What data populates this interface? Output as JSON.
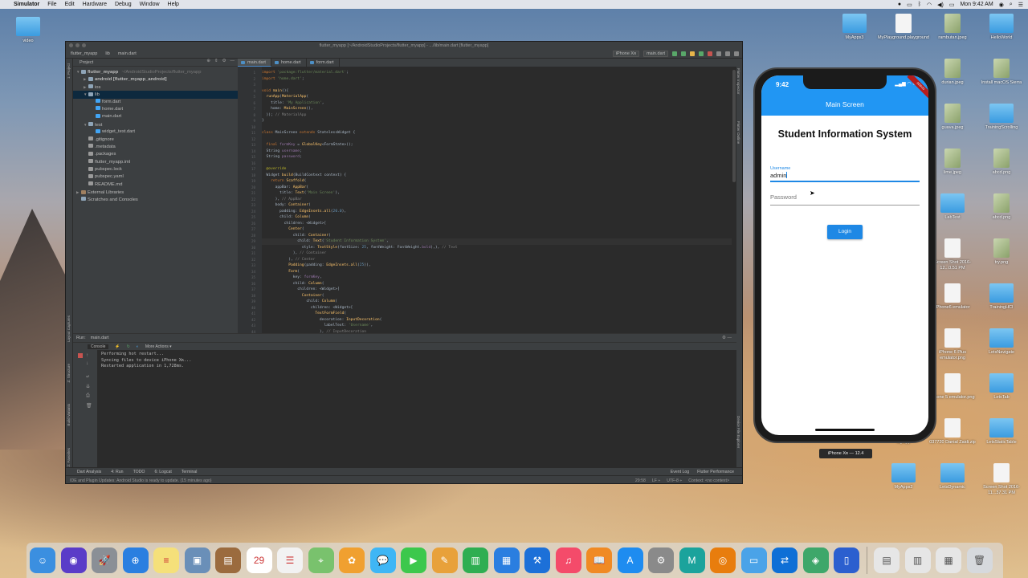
{
  "menubar": {
    "apple": "",
    "items": [
      "Simulator",
      "File",
      "Edit",
      "Hardware",
      "Debug",
      "Window",
      "Help"
    ],
    "clock": "Mon 9:42 AM"
  },
  "desktop": {
    "left_icons": [
      {
        "label": "video"
      }
    ],
    "right_icons": [
      {
        "label": "MyApps3",
        "kind": "folder",
        "col": 0,
        "row": 0
      },
      {
        "label": "MyPlayground.playground",
        "kind": "file",
        "col": 1,
        "row": 0
      },
      {
        "label": "rambutan.jpeg",
        "kind": "img",
        "col": 2,
        "row": 0
      },
      {
        "label": "HelloWorld",
        "kind": "folder",
        "col": 3,
        "row": 0
      },
      {
        "label": "durian.jpeg",
        "kind": "img",
        "col": 2,
        "row": 1
      },
      {
        "label": "Install macOS Sierra",
        "kind": "img",
        "col": 3,
        "row": 1
      },
      {
        "label": "guava.jpeg",
        "kind": "img",
        "col": 2,
        "row": 2
      },
      {
        "label": "TrainingScrolling",
        "kind": "folder",
        "col": 3,
        "row": 2
      },
      {
        "label": "lime.jpeg",
        "kind": "img",
        "col": 2,
        "row": 3
      },
      {
        "label": "abcd.png",
        "kind": "img",
        "col": 3,
        "row": 3
      },
      {
        "label": "LabTest",
        "kind": "folder",
        "col": 2,
        "row": 4
      },
      {
        "label": "abcd.png",
        "kind": "img",
        "col": 3,
        "row": 4
      },
      {
        "label": "Screen Shot 2016-12...0.51 PM",
        "kind": "file",
        "col": 2,
        "row": 5
      },
      {
        "label": "try.png",
        "kind": "img",
        "col": 3,
        "row": 5
      },
      {
        "label": "iPhone6 emulator",
        "kind": "file",
        "col": 2,
        "row": 6
      },
      {
        "label": "TrainingHCI",
        "kind": "folder",
        "col": 3,
        "row": 6
      },
      {
        "label": "iPhone 6 Plus emulator.png",
        "kind": "file",
        "col": 2,
        "row": 7
      },
      {
        "label": "LetsNavigate",
        "kind": "folder",
        "col": 3,
        "row": 7
      },
      {
        "label": "iPhone 5 emulator.png",
        "kind": "file",
        "col": 2,
        "row": 8
      },
      {
        "label": "LetsTab",
        "kind": "folder",
        "col": 3,
        "row": 8
      },
      {
        "label": "MyApp",
        "kind": "folder",
        "col": 1,
        "row": 9
      },
      {
        "label": "037720 Danial Zaidi.zip",
        "kind": "file",
        "col": 2,
        "row": 9
      },
      {
        "label": "LetsStaticTable",
        "kind": "folder",
        "col": 3,
        "row": 9
      },
      {
        "label": "MyApps2",
        "kind": "folder",
        "col": 1,
        "row": 10
      },
      {
        "label": "LetsDynamic",
        "kind": "folder",
        "col": 2,
        "row": 10
      },
      {
        "label": "Screen Shot 2016-11...37.31 PM",
        "kind": "file",
        "col": 3,
        "row": 10
      }
    ]
  },
  "ide": {
    "title": "flutter_myapp [~/AndroidStudioProjects/flutter_myapp] - .../lib/main.dart [flutter_myapp]",
    "breadcrumbs": [
      "flutter_myapp",
      "lib",
      "main.dart"
    ],
    "device_selector": "iPhone Xʀ",
    "run_config": "main.dart",
    "project_panel_title": "Project",
    "tree": [
      {
        "label": "flutter_myapp",
        "extra": "~/AndroidStudioProjects/flutter_myapp",
        "depth": 0,
        "arrow": "▼",
        "icon": "folder",
        "bold": true
      },
      {
        "label": "android [flutter_myapp_android]",
        "depth": 1,
        "arrow": "▶",
        "icon": "folder",
        "bold": true
      },
      {
        "label": "ios",
        "depth": 1,
        "arrow": "▶",
        "icon": "folder"
      },
      {
        "label": "lib",
        "depth": 1,
        "arrow": "▼",
        "icon": "folder",
        "selected": true
      },
      {
        "label": "form.dart",
        "depth": 2,
        "icon": "dart"
      },
      {
        "label": "home.dart",
        "depth": 2,
        "icon": "dart"
      },
      {
        "label": "main.dart",
        "depth": 2,
        "icon": "dart"
      },
      {
        "label": "test",
        "depth": 1,
        "arrow": "▼",
        "icon": "folder"
      },
      {
        "label": "widget_test.dart",
        "depth": 2,
        "icon": "dart"
      },
      {
        "label": ".gitignore",
        "depth": 1,
        "icon": "file"
      },
      {
        "label": ".metadata",
        "depth": 1,
        "icon": "file"
      },
      {
        "label": ".packages",
        "depth": 1,
        "icon": "file"
      },
      {
        "label": "flutter_myapp.iml",
        "depth": 1,
        "icon": "file"
      },
      {
        "label": "pubspec.lock",
        "depth": 1,
        "icon": "file"
      },
      {
        "label": "pubspec.yaml",
        "depth": 1,
        "icon": "file"
      },
      {
        "label": "README.md",
        "depth": 1,
        "icon": "file"
      },
      {
        "label": "External Libraries",
        "depth": 0,
        "arrow": "▶",
        "icon": "lib"
      },
      {
        "label": "Scratches and Consoles",
        "depth": 0,
        "icon": "scratch"
      }
    ],
    "tabs": [
      "main.dart",
      "home.dart",
      "form.dart"
    ],
    "line_start": 1,
    "code": [
      [
        [
          "kw",
          "import "
        ],
        [
          "str",
          "'package:flutter/material.dart'"
        ],
        [
          "",
          "; "
        ]
      ],
      [
        [
          "kw",
          "import "
        ],
        [
          "str",
          "'home.dart'"
        ],
        [
          "",
          ";"
        ]
      ],
      [
        [
          "",
          ""
        ]
      ],
      [
        [
          "kw",
          "void "
        ],
        [
          "fn",
          "main"
        ],
        [
          "",
          "(){"
        ]
      ],
      [
        [
          "",
          "  "
        ],
        [
          "fn",
          "runApp"
        ],
        [
          "",
          "("
        ],
        [
          "fn",
          "MaterialApp"
        ],
        [
          "",
          "("
        ]
      ],
      [
        [
          "",
          "    title: "
        ],
        [
          "str",
          "'My Application'"
        ],
        [
          "",
          ","
        ]
      ],
      [
        [
          "",
          "    home: "
        ],
        [
          "fn",
          "MainScreen"
        ],
        [
          "",
          "(),"
        ]
      ],
      [
        [
          "",
          "  )); "
        ],
        [
          "cm",
          "// MaterialApp"
        ]
      ],
      [
        [
          "",
          "}"
        ]
      ],
      [
        [
          "",
          ""
        ]
      ],
      [
        [
          "kw",
          "class "
        ],
        [
          "cls",
          "MainScreen "
        ],
        [
          "kw",
          "extends "
        ],
        [
          "",
          "StatelessWidget {"
        ]
      ],
      [
        [
          "",
          ""
        ]
      ],
      [
        [
          "",
          "  "
        ],
        [
          "kw",
          "final "
        ],
        [
          "pur",
          "formKey"
        ],
        [
          "",
          " = "
        ],
        [
          "fn",
          "GlobalKey"
        ],
        [
          "",
          "<FormState>();"
        ]
      ],
      [
        [
          "",
          "  String "
        ],
        [
          "pur",
          "username"
        ],
        [
          "",
          ";"
        ]
      ],
      [
        [
          "",
          "  String "
        ],
        [
          "pur",
          "password"
        ],
        [
          "",
          ";"
        ]
      ],
      [
        [
          "",
          ""
        ]
      ],
      [
        [
          "ann",
          "  @override"
        ]
      ],
      [
        [
          "",
          "  Widget "
        ],
        [
          "fn",
          "build"
        ],
        [
          "",
          "(BuildContext context) {"
        ]
      ],
      [
        [
          "",
          "    "
        ],
        [
          "kw",
          "return "
        ],
        [
          "fn",
          "Scaffold"
        ],
        [
          "",
          "("
        ]
      ],
      [
        [
          "",
          "      appBar: "
        ],
        [
          "fn",
          "AppBar"
        ],
        [
          "",
          "("
        ]
      ],
      [
        [
          "",
          "        title: "
        ],
        [
          "fn",
          "Text"
        ],
        [
          "",
          "("
        ],
        [
          "str",
          "'Main Screen'"
        ],
        [
          "",
          "),"
        ]
      ],
      [
        [
          "",
          "      ), "
        ],
        [
          "cm",
          "// AppBar"
        ]
      ],
      [
        [
          "",
          "      body: "
        ],
        [
          "fn",
          "Container"
        ],
        [
          "",
          "("
        ]
      ],
      [
        [
          "",
          "        padding: "
        ],
        [
          "fn",
          "EdgeInsets.all"
        ],
        [
          "",
          "("
        ],
        [
          "num",
          "20.0"
        ],
        [
          "",
          "),"
        ]
      ],
      [
        [
          "",
          "        child: "
        ],
        [
          "fn",
          "Column"
        ],
        [
          "",
          "("
        ]
      ],
      [
        [
          "",
          "          children: <Widget>["
        ]
      ],
      [
        [
          "",
          "            "
        ],
        [
          "fn",
          "Center"
        ],
        [
          "",
          "("
        ]
      ],
      [
        [
          "",
          "              child: "
        ],
        [
          "fn",
          "Container"
        ],
        [
          "",
          "("
        ]
      ],
      [
        [
          "",
          "                child: "
        ],
        [
          "fn",
          "Text"
        ],
        [
          "",
          "("
        ],
        [
          "str",
          "'Student Information System'"
        ],
        [
          "",
          ","
        ]
      ],
      [
        [
          "",
          "                  style: "
        ],
        [
          "fn",
          "TextStyle"
        ],
        [
          "",
          "(fontSize: "
        ],
        [
          "num",
          "25"
        ],
        [
          "",
          ", fontWeight: FontWeight."
        ],
        [
          "pur",
          "bold"
        ],
        [
          "",
          "),), "
        ],
        [
          "cm",
          "// Text"
        ]
      ],
      [
        [
          "",
          "              ), "
        ],
        [
          "cm",
          "// Container"
        ]
      ],
      [
        [
          "",
          "            ), "
        ],
        [
          "cm",
          "// Center"
        ]
      ],
      [
        [
          "",
          "            "
        ],
        [
          "fn",
          "Padding"
        ],
        [
          "",
          "(padding: "
        ],
        [
          "fn",
          "EdgeInsets.all"
        ],
        [
          "",
          "("
        ],
        [
          "num",
          "25"
        ],
        [
          "",
          ")),"
        ]
      ],
      [
        [
          "",
          "            "
        ],
        [
          "fn",
          "Form"
        ],
        [
          "",
          "("
        ]
      ],
      [
        [
          "",
          "              key: "
        ],
        [
          "pur",
          "formKey"
        ],
        [
          "",
          ","
        ]
      ],
      [
        [
          "",
          "              child: "
        ],
        [
          "fn",
          "Column"
        ],
        [
          "",
          "("
        ]
      ],
      [
        [
          "",
          "                children: <Widget>["
        ]
      ],
      [
        [
          "",
          "                  "
        ],
        [
          "fn",
          "Container"
        ],
        [
          "",
          "("
        ]
      ],
      [
        [
          "",
          "                    child: "
        ],
        [
          "fn",
          "Column"
        ],
        [
          "",
          "("
        ]
      ],
      [
        [
          "",
          "                      children: <Widget>["
        ]
      ],
      [
        [
          "",
          "                        "
        ],
        [
          "fn",
          "TextFormField"
        ],
        [
          "",
          "("
        ]
      ],
      [
        [
          "",
          "                          decoration: "
        ],
        [
          "fn",
          "InputDecoration"
        ],
        [
          "",
          "("
        ]
      ],
      [
        [
          "",
          "                            labelText: "
        ],
        [
          "str",
          "'Username'"
        ],
        [
          "",
          ","
        ]
      ],
      [
        [
          "",
          "                          ), "
        ],
        [
          "cm",
          "// InputDecoration"
        ]
      ]
    ],
    "highlight_line": 29,
    "run_label": "Run:",
    "run_tab": "main.dart",
    "console_tab": "Console",
    "more_actions": "More Actions ▾",
    "console_lines": [
      "Performing hot restart...",
      "Syncing files to device iPhone Xʀ...",
      "Restarted application in 1,728ms."
    ],
    "bottom_tools": [
      "Dart Analysis",
      "4: Run",
      "TODO",
      "6: Logcat",
      "Terminal"
    ],
    "bottom_right": [
      "Event Log",
      "Flutter Performance"
    ],
    "status_text": "IDE and Plugin Updates: Android Studio is ready to update. (15 minutes ago)",
    "status_right": [
      "29:58",
      "LF ÷",
      "UTF-8 ÷",
      "Context: <no context>"
    ],
    "left_vlabels": [
      "1: Project",
      "Layout Captures",
      "Z: Structure",
      "Build Variants",
      "2: Favorites"
    ],
    "right_vlabels": [
      "Flutter Inspector",
      "Flutter Outline",
      "Device File Explorer"
    ]
  },
  "simulator": {
    "time": "9:42",
    "appbar_title": "Main Screen",
    "debug_banner": "DEBUG",
    "heading": "Student Information System",
    "username_label": "Username",
    "username_value": "admin",
    "password_placeholder": "Password",
    "login_label": "Login",
    "device_label": "iPhone Xʀ — 12.4"
  },
  "dock": {
    "apps": [
      {
        "name": "finder",
        "color": "#3b8fe0",
        "glyph": "☺"
      },
      {
        "name": "siri",
        "color": "#5a3cc8",
        "glyph": "◉"
      },
      {
        "name": "launchpad",
        "color": "#8a8f96",
        "glyph": "🚀"
      },
      {
        "name": "safari",
        "color": "#2a7fe0",
        "glyph": "⊕"
      },
      {
        "name": "notes",
        "color": "#f5e07a",
        "glyph": "≡"
      },
      {
        "name": "preview",
        "color": "#6a8fb8",
        "glyph": "▣"
      },
      {
        "name": "contacts",
        "color": "#9b6b3e",
        "glyph": "▤"
      },
      {
        "name": "calendar",
        "color": "#ffffff",
        "glyph": "29"
      },
      {
        "name": "reminders",
        "color": "#f2f2f2",
        "glyph": "☰"
      },
      {
        "name": "maps",
        "color": "#79c26d",
        "glyph": "⌖"
      },
      {
        "name": "photos",
        "color": "#f0a030",
        "glyph": "✿"
      },
      {
        "name": "messages",
        "color": "#3fb6f5",
        "glyph": "💬"
      },
      {
        "name": "facetime",
        "color": "#3cc84c",
        "glyph": "▶"
      },
      {
        "name": "pages",
        "color": "#e8a13a",
        "glyph": "✎"
      },
      {
        "name": "numbers",
        "color": "#2fae51",
        "glyph": "▥"
      },
      {
        "name": "keynote",
        "color": "#2a7ee0",
        "glyph": "▦"
      },
      {
        "name": "xcode",
        "color": "#1c70d8",
        "glyph": "⚒"
      },
      {
        "name": "music",
        "color": "#f44b6a",
        "glyph": "♫"
      },
      {
        "name": "books",
        "color": "#f08a24",
        "glyph": "📖"
      },
      {
        "name": "app-store",
        "color": "#1e8cf0",
        "glyph": "A"
      },
      {
        "name": "system-preferences",
        "color": "#8a8a8a",
        "glyph": "⚙"
      },
      {
        "name": "maya",
        "color": "#1ba39c",
        "glyph": "M"
      },
      {
        "name": "blender",
        "color": "#e87d0d",
        "glyph": "◎"
      },
      {
        "name": "folder",
        "color": "#4aa3e8",
        "glyph": "▭"
      },
      {
        "name": "teamviewer",
        "color": "#0e6fd6",
        "glyph": "⇄"
      },
      {
        "name": "android-studio",
        "color": "#3ea76a",
        "glyph": "◈"
      },
      {
        "name": "simulator",
        "color": "#2b5fcf",
        "glyph": "▯"
      }
    ],
    "right_items": [
      {
        "name": "downloads-stack",
        "color": "#e6e6e6",
        "glyph": "▤"
      },
      {
        "name": "documents-stack",
        "color": "#e6e6e6",
        "glyph": "▥"
      },
      {
        "name": "screenshots-stack",
        "color": "#e6e6e6",
        "glyph": "▦"
      },
      {
        "name": "trash",
        "color": "#d6d9dd",
        "glyph": "🗑"
      }
    ]
  }
}
